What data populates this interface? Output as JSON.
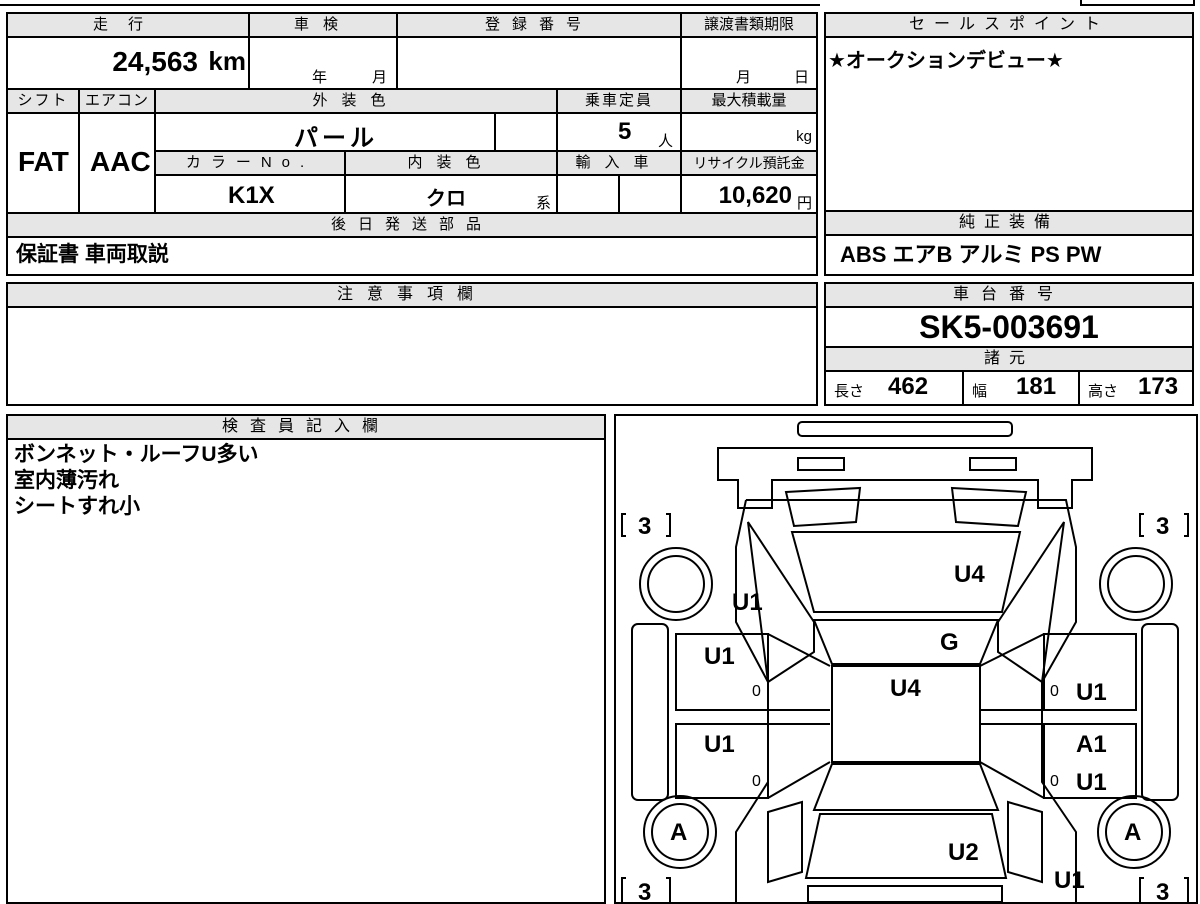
{
  "vehicle": {
    "mileage_label": "走行",
    "mileage": "24,563",
    "mileage_unit": "km",
    "inspection_label": "車検",
    "year_unit": "年",
    "month_unit": "月",
    "registration_label": "登録番号",
    "transfer_deadline_label": "譲渡書類期限",
    "day_unit": "日",
    "shift_label": "シフト",
    "shift": "FAT",
    "ac_label": "エアコン",
    "ac": "AAC",
    "exterior_color_label": "外装色",
    "exterior_color": "パール",
    "capacity_label": "乗車定員",
    "capacity": "5",
    "capacity_unit": "人",
    "max_load_label": "最大積載量",
    "max_load_unit": "kg",
    "color_no_label": "カラーNo.",
    "color_no": "K1X",
    "interior_color_label": "内装色",
    "interior_color": "クロ",
    "interior_suffix": "系",
    "import_label": "輸入車",
    "recycle_label": "リサイクル預託金",
    "recycle_fee": "10,620",
    "recycle_unit": "円"
  },
  "sales_point": {
    "label": "セールスポイント",
    "text": "★オークションデビュー★"
  },
  "later_parts": {
    "label": "後日発送部品",
    "text": "保証書 車両取説"
  },
  "equipment": {
    "label": "純正装備",
    "text": "ABS エアB アルミ PS PW"
  },
  "notes": {
    "label": "注意事項欄",
    "text": ""
  },
  "chassis": {
    "label": "車台番号",
    "number": "SK5-003691",
    "specs_label": "諸元",
    "length_label": "長さ",
    "length": "462",
    "width_label": "幅",
    "width": "181",
    "height_label": "高さ",
    "height": "173"
  },
  "inspector": {
    "label": "検査員記入欄",
    "lines": [
      "ボンネット・ルーフU多い",
      "室内薄汚れ",
      "シートすれ小"
    ]
  },
  "diagram": {
    "tire_depth_fl": "3",
    "tire_depth_fr": "3",
    "tire_depth_rl": "3",
    "tire_depth_rr": "3",
    "marks": {
      "hood": "U4",
      "front_left_fender": "U1",
      "windshield": "G",
      "roof": "U4",
      "left_front_door": "U1",
      "left_front_door_zero": "0",
      "left_rear_door": "U1",
      "left_rear_door_zero": "0",
      "right_front_door": "U1",
      "right_front_door_zero": "0",
      "right_rear_door_a": "A1",
      "right_rear_door_u": "U1",
      "right_rear_door_zero": "0",
      "rear_left_wheel": "A",
      "rear_right_wheel": "A",
      "rear_hatch": "U2",
      "rear_right_quarter": "U1"
    }
  }
}
